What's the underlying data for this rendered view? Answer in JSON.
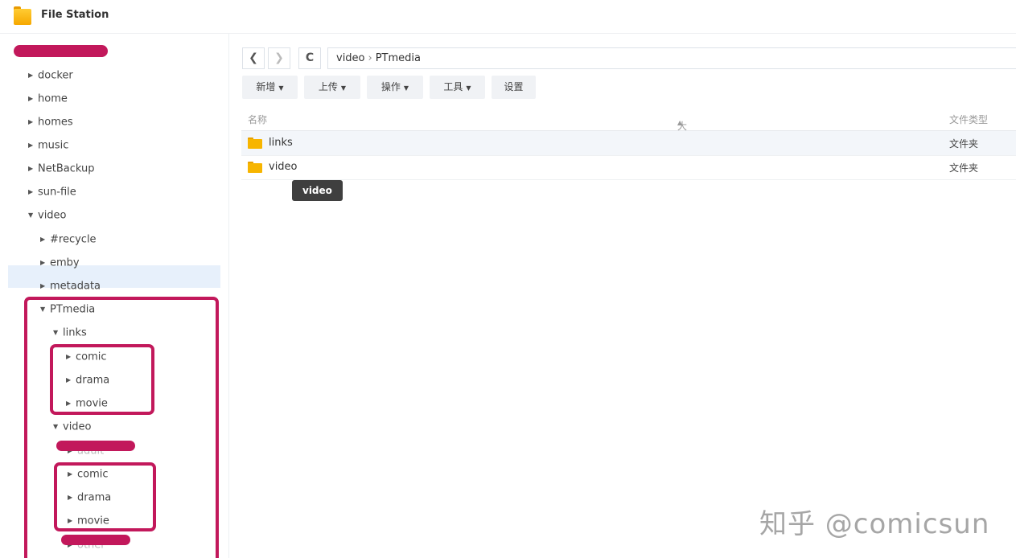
{
  "app": {
    "title": "File Station"
  },
  "sidebar": {
    "root": [
      "docker",
      "home",
      "homes",
      "music",
      "NetBackup",
      "sun-file",
      "video"
    ],
    "video_children": [
      "#recycle",
      "emby",
      "metadata",
      "PTmedia"
    ],
    "ptmedia_children": [
      "links",
      "video"
    ],
    "links_children": [
      "comic",
      "drama",
      "movie"
    ],
    "video_children2": [
      "adult",
      "comic",
      "drama",
      "movie",
      "other"
    ]
  },
  "toolbar": {
    "back_icon": "chevron-left-icon",
    "forward_icon": "chevron-right-icon",
    "refresh_icon": "refresh-icon",
    "path": [
      "video",
      "PTmedia"
    ],
    "buttons": {
      "create": "新增",
      "upload": "上传",
      "action": "操作",
      "tools": "工具",
      "settings": "设置"
    }
  },
  "file_list": {
    "columns": {
      "name": "名称",
      "size": "大小",
      "type": "文件类型"
    },
    "rows": [
      {
        "name": "links",
        "type": "文件夹"
      },
      {
        "name": "video",
        "type": "文件夹"
      }
    ]
  },
  "tooltip": "video",
  "watermark": "知乎 @comicsun",
  "colors": {
    "highlight": "#c2185b",
    "folder": "#f7b500",
    "selection": "#e7f0fb"
  }
}
